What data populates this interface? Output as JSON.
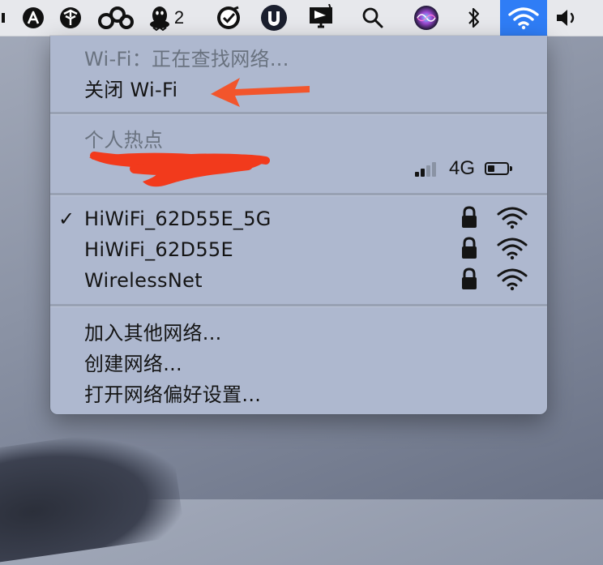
{
  "menubar": {
    "qq_badge": "2",
    "icons": [
      "app-a-icon",
      "app-cube-icon",
      "app-infinity-icon",
      "qq-penguin-icon",
      "check-app-icon",
      "shield-app-icon",
      "flag-display-icon",
      "spotlight-search-icon",
      "siri-icon",
      "bluetooth-icon",
      "wifi-icon",
      "volume-icon"
    ]
  },
  "wifi_menu": {
    "status": "Wi-Fi：正在查找网络...",
    "toggle_label": "关闭 Wi-Fi",
    "hotspot_header": "个人热点",
    "hotspot": {
      "name": "",
      "signal_bars": 2,
      "signal_max": 4,
      "network_type": "4G",
      "battery_level": 0.35
    },
    "networks": [
      {
        "ssid": "HiWiFi_62D55E_5G",
        "connected": true,
        "locked": true
      },
      {
        "ssid": "HiWiFi_62D55E",
        "connected": false,
        "locked": true
      },
      {
        "ssid": "WirelessNet",
        "connected": false,
        "locked": true
      }
    ],
    "check_mark": "✓",
    "actions": {
      "join_other": "加入其他网络...",
      "create": "创建网络...",
      "preferences": "打开网络偏好设置..."
    }
  },
  "annotation": {
    "arrow_color": "#f2552c",
    "redaction_color": "#f23a1c"
  },
  "colors": {
    "menu_bg": "#aeb8cf",
    "wifi_highlight": "#2f7df6",
    "dim_text": "#69727f"
  }
}
